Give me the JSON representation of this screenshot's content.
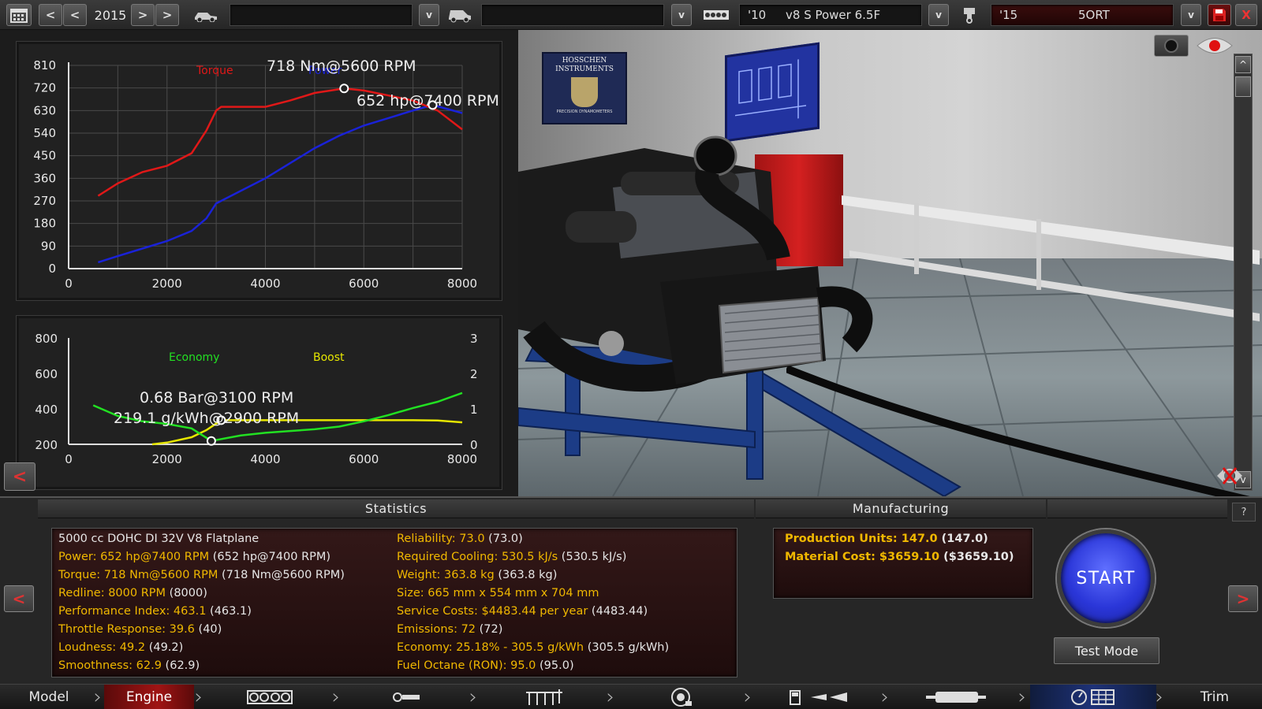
{
  "toolbar": {
    "year": "2015",
    "prev_label": "<",
    "next_label": ">",
    "dropdown_label": "v",
    "engine_year": "'10",
    "engine_name": "v8 S Power 6.5F",
    "variant_year": "'15",
    "variant_name": "5ORT",
    "save_icon": "floppy-disk-icon",
    "close_label": "X"
  },
  "charts": {
    "upper": {
      "torque_label": "Torque",
      "power_label": "Power",
      "torque_peak": "718 Nm@5600 RPM",
      "power_peak": "652 hp@7400 RPM",
      "y_ticks": [
        "810",
        "720",
        "630",
        "540",
        "450",
        "360",
        "270",
        "180",
        "90",
        "0"
      ],
      "x_ticks": [
        "0",
        "2000",
        "4000",
        "6000",
        "8000"
      ]
    },
    "lower": {
      "economy_label": "Economy",
      "boost_label": "Boost",
      "boost_peak": "0.68 Bar@3100 RPM",
      "economy_peak": "219.1 g/kWh@2900 RPM",
      "y_left_ticks": [
        "800",
        "600",
        "400",
        "200"
      ],
      "y_right_ticks": [
        "3",
        "2",
        "1",
        "0"
      ],
      "x_ticks": [
        "0",
        "2000",
        "4000",
        "6000",
        "8000"
      ]
    },
    "colors": {
      "torque": "#e01818",
      "power": "#1a22d8",
      "economy": "#22e022",
      "boost": "#e6e600"
    }
  },
  "chart_data": [
    {
      "type": "line",
      "xlabel": "",
      "ylabel": "",
      "xlim": [
        0,
        8000
      ],
      "ylim": [
        0,
        810
      ],
      "grid": true,
      "series": [
        {
          "name": "Torque",
          "x": [
            600,
            1000,
            1500,
            2000,
            2500,
            2800,
            3000,
            3100,
            3500,
            4000,
            4500,
            5000,
            5600,
            6000,
            6500,
            7000,
            7500,
            8000
          ],
          "y": [
            290,
            340,
            385,
            410,
            460,
            550,
            630,
            645,
            645,
            645,
            670,
            700,
            718,
            710,
            690,
            670,
            630,
            555
          ]
        },
        {
          "name": "Power",
          "x": [
            600,
            1000,
            1500,
            2000,
            2500,
            2800,
            3000,
            3500,
            4000,
            4500,
            5000,
            5500,
            6000,
            6500,
            7000,
            7400,
            8000
          ],
          "y": [
            25,
            50,
            80,
            110,
            150,
            200,
            260,
            310,
            360,
            420,
            480,
            530,
            570,
            600,
            630,
            652,
            620
          ]
        }
      ]
    },
    {
      "type": "line",
      "xlabel": "",
      "ylabel": "",
      "xlim": [
        0,
        8000
      ],
      "ylim": [
        200,
        800
      ],
      "y2lim": [
        0,
        3
      ],
      "grid": false,
      "series": [
        {
          "name": "Economy",
          "axis": "left",
          "x": [
            500,
            1000,
            1500,
            2000,
            2500,
            2900,
            3500,
            4000,
            4500,
            5000,
            5500,
            6000,
            6500,
            7000,
            7500,
            8000
          ],
          "y": [
            420,
            360,
            330,
            315,
            290,
            219,
            250,
            265,
            275,
            285,
            300,
            330,
            365,
            405,
            440,
            490
          ]
        },
        {
          "name": "Boost",
          "axis": "right",
          "x": [
            1700,
            2000,
            2500,
            2800,
            3100,
            3500,
            4000,
            5000,
            6000,
            7000,
            7500,
            8000
          ],
          "y": [
            0,
            0.05,
            0.2,
            0.4,
            0.68,
            0.68,
            0.68,
            0.68,
            0.68,
            0.68,
            0.67,
            0.62
          ]
        }
      ]
    }
  ],
  "viewport": {
    "poster_title": "HOSSCHEN INSTRUMENTS",
    "poster_sub": "PRECISION DYNAMOMETERS",
    "record_icon": "record-icon",
    "eye_icon": "eye-icon",
    "scroll_up": "^",
    "scroll_down": "v",
    "reset_view_icon": "reset-view-icon"
  },
  "statistics": {
    "title": "Statistics",
    "left": [
      {
        "k": "5000 cc DOHC DI 32V V8 Flatplane",
        "v": "",
        "plain": true
      },
      {
        "k": "Power: 652 hp@7400 RPM",
        "v": " (652 hp@7400 RPM)"
      },
      {
        "k": "Torque: 718 Nm@5600 RPM",
        "v": " (718 Nm@5600 RPM)"
      },
      {
        "k": "Redline: 8000 RPM",
        "v": " (8000)"
      },
      {
        "k": "Performance Index: 463.1",
        "v": " (463.1)"
      },
      {
        "k": "Throttle Response: 39.6",
        "v": " (40)"
      },
      {
        "k": "Loudness: 49.2",
        "v": " (49.2)"
      },
      {
        "k": "Smoothness: 62.9",
        "v": " (62.9)"
      }
    ],
    "right": [
      {
        "k": "Reliability: 73.0",
        "v": " (73.0)"
      },
      {
        "k": "Required Cooling: 530.5 kJ/s",
        "v": " (530.5 kJ/s)"
      },
      {
        "k": "Weight: 363.8 kg",
        "v": " (363.8 kg)"
      },
      {
        "k": "Size: 665 mm x 554 mm x 704 mm",
        "v": ""
      },
      {
        "k": "Service Costs: $4483.44 per year",
        "v": " (4483.44)"
      },
      {
        "k": "Emissions: 72",
        "v": " (72)"
      },
      {
        "k": "Economy: 25.18% - 305.5 g/kWh",
        "v": " (305.5 g/kWh)"
      },
      {
        "k": "Fuel Octane (RON): 95.0",
        "v": " (95.0)"
      }
    ]
  },
  "manufacturing": {
    "title": "Manufacturing",
    "rows": [
      {
        "k": "Production Units: 147.0",
        "v": " (147.0)"
      },
      {
        "k": "Material Cost: $3659.10",
        "v": " ($3659.10)"
      }
    ]
  },
  "actions": {
    "start_label": "START",
    "test_mode_label": "Test Mode",
    "help_label": "?",
    "left_label": "<",
    "right_label": ">"
  },
  "nav": {
    "model_label": "Model",
    "engine_label": "Engine",
    "trim_label": "Trim",
    "icons": [
      "block-icon",
      "crank-icon",
      "head-icon",
      "turbo-icon",
      "fuel-icon",
      "exhaust-icon",
      "dyno-icon"
    ]
  }
}
